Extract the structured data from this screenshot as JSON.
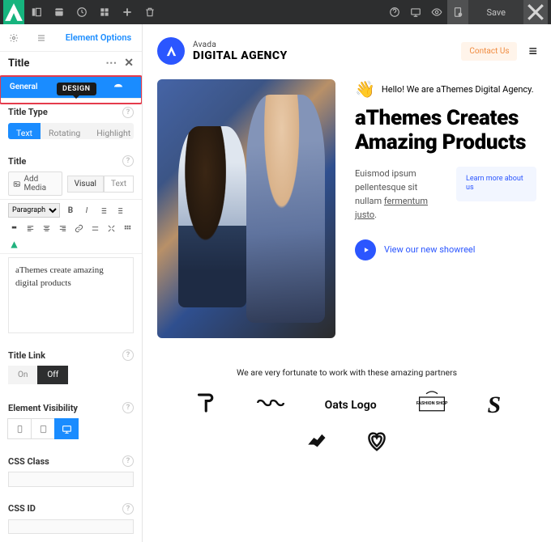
{
  "topbar": {
    "save_label": "Save"
  },
  "sidebar": {
    "elem_options": "Element Options",
    "panel_title": "Title",
    "design_tag": "DESIGN",
    "subtab_general": "General",
    "section_title_type": "Title Type",
    "type_tabs": {
      "text": "Text",
      "rotating": "Rotating",
      "highlight": "Highlight"
    },
    "section_title": "Title",
    "add_media": "Add Media",
    "editor_tabs": {
      "visual": "Visual",
      "text": "Text"
    },
    "paragraph_select": "Paragraph",
    "editor_content": "aThemes create amazing digital products",
    "section_title_link": "Title Link",
    "on": "On",
    "off": "Off",
    "section_elem_vis": "Element Visibility",
    "section_css_class": "CSS Class",
    "section_css_id": "CSS ID"
  },
  "preview": {
    "brand_small": "Avada",
    "brand_big": "DIGITAL AGENCY",
    "contact": "Contact Us",
    "hello": "Hello! We are aThemes Digital Agency.",
    "hero_title": "aThemes Creates Amazing Products",
    "desc_1": "Euismod ipsum pellentesque sit nullam ",
    "desc_2_u": "fermentum justo",
    "desc_3": ".",
    "learn_more": "Learn more about us",
    "showreel": "View our new showreel",
    "partners_text": "We are very fortunate to work with these amazing partners",
    "oats_logo": "Oats Logo",
    "fashion_shop": "FASHION SHOP"
  }
}
